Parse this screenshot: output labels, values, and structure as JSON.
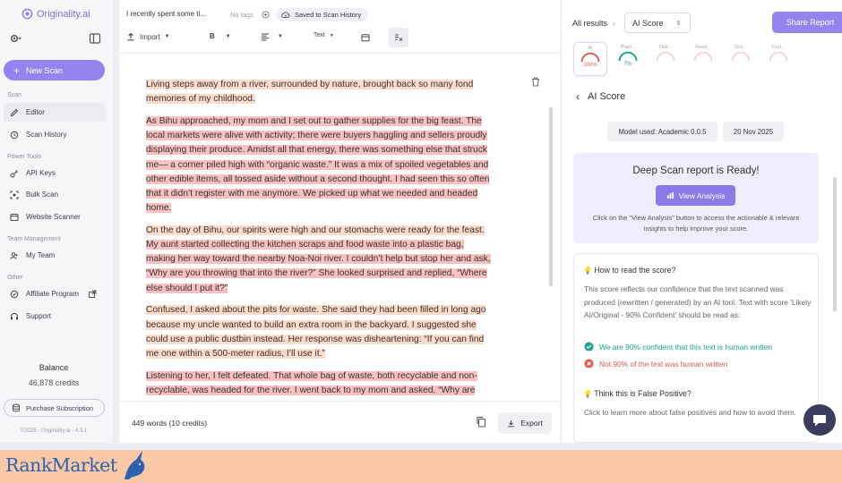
{
  "sidebar": {
    "brand": "Originality.ai",
    "new_scan": "New Scan",
    "sections": {
      "scan": "Scan",
      "power_tools": "Power Tools",
      "team": "Team Management",
      "other": "Other"
    },
    "items": {
      "editor": "Editor",
      "scan_history": "Scan History",
      "api_keys": "API Keys",
      "bulk_scan": "Bulk Scan",
      "website_scanner": "Website Scanner",
      "my_team": "My Team",
      "affiliate": "Affiliate Program",
      "support": "Support"
    },
    "balance_label": "Balance",
    "balance_value": "46,878 credits",
    "purchase": "Purchase Subscription",
    "copyright": "©2025 - Originality.ai - 4.3.1"
  },
  "editor": {
    "title": "I recently spent some ti...",
    "no_tags": "No tags",
    "saved": "Saved to Scan History",
    "import": "Import",
    "bold": "B",
    "text_style": "Text",
    "paragraphs": [
      [
        {
          "t": "Living steps away from a river, surrounded by nature, brought back so many fond memories of my childhood.",
          "h": "o"
        }
      ],
      [
        {
          "t": "As Bihu approached, my mom and I set out to gather supplies for the big feast. The local markets were alive with activity; there were buyers haggling and sellers proudly displaying their produce. Amidst all that energy, there was something else that struck me— a corner piled high with “organic waste.” It was a mix of spoiled vegetables and other edible items, all tossed aside without a second thought. I had seen this so often that it didn’t register with me anymore. We picked up what we needed and headed home.",
          "h": "r"
        }
      ],
      [
        {
          "t": "On the day of Bihu, our spirits were high and our stomachs were ready for the feast. ",
          "h": "o"
        },
        {
          "t": "My aunt started collecting the kitchen scraps and food waste into a plastic bag, making her way toward the nearby Noa-Noi river. I couldn’t help but stop her and ask, “Why are you throwing that into the river?” She looked surprised and replied, “Where else should I put it?”",
          "h": "r"
        }
      ],
      [
        {
          "t": "Confused, I asked about the pits for waste. She said they had been filled in long ago because my uncle wanted to build an extra room in the backyard. I suggested she could use a public dustbin instead. Her response was disheartening: “If you can find me one within a 500-meter radius, I’ll use it.”",
          "h": "o"
        }
      ],
      [
        {
          "t": "Listening to her, I felt defeated. That whole bag of waste, both recyclable and non-recyclable, was headed for the river. I went back to my mom and asked, “Why are",
          "h": "r"
        }
      ]
    ],
    "word_count": "449 words (10 credits)",
    "export": "Export"
  },
  "panel": {
    "all_results": "All results",
    "selector": "AI Score",
    "share": "Share Report",
    "tabs": [
      {
        "label": "AI",
        "value": "100%",
        "color": "#e05a4f"
      },
      {
        "label": "Plagi...",
        "value": "7%",
        "color": "#19a58a"
      },
      {
        "label": "Opti...",
        "value": "",
        "color": "#e8a0a0"
      },
      {
        "label": "Read...",
        "value": "",
        "color": "#e8a0a0"
      },
      {
        "label": "Gra...",
        "value": "",
        "color": "#e8a0a0"
      },
      {
        "label": "Fact...",
        "value": "",
        "color": "#e8a0a0"
      }
    ],
    "ai_score_title": "AI Score",
    "model": "Model used: Academic 0.0.5",
    "date": "20 Nov 2025",
    "deep_title": "Deep Scan report is Ready!",
    "view_analysis": "View Analysis",
    "deep_desc": "Click on the \"View Analysis\" button to access the actionable & relevant insights to help improve your score.",
    "how_title": "How to read the score?",
    "how_body": "This score reflects our confidence that the text scanned was produced (rewritten / generated) by an AI tool. Text with score 'Likely AI/Original - 90% Confident' should be read as:",
    "line_good": "We are 90% confident that this text is human written",
    "line_bad": "Not 90% of the text was human written",
    "fp_title": "Think this is False Positive?",
    "fp_body": "Click to learn more about false positives and how to avoid them."
  },
  "watermark": "RankMarket",
  "colors": {
    "accent": "#9384f0",
    "ai_red": "#e05a4f",
    "green": "#19a58a",
    "highlight_red": "#f6c1bf",
    "highlight_orange": "#fbdccb"
  }
}
